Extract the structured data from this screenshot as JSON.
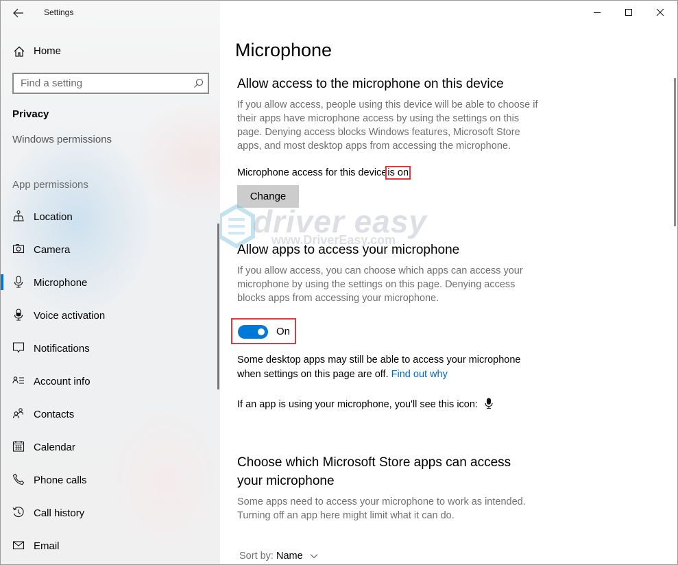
{
  "window": {
    "title": "Settings",
    "controls": {
      "minimize": "minimize",
      "maximize": "maximize",
      "close": "close"
    }
  },
  "sidebar": {
    "home_label": "Home",
    "search_placeholder": "Find a setting",
    "section_title": "Privacy",
    "partial_item": "Windows permissions",
    "group_label": "App permissions",
    "items": [
      {
        "label": "Location",
        "icon": "location-icon",
        "selected": false
      },
      {
        "label": "Camera",
        "icon": "camera-icon",
        "selected": false
      },
      {
        "label": "Microphone",
        "icon": "microphone-icon",
        "selected": true
      },
      {
        "label": "Voice activation",
        "icon": "voice-activation-icon",
        "selected": false
      },
      {
        "label": "Notifications",
        "icon": "notifications-icon",
        "selected": false
      },
      {
        "label": "Account info",
        "icon": "account-info-icon",
        "selected": false
      },
      {
        "label": "Contacts",
        "icon": "contacts-icon",
        "selected": false
      },
      {
        "label": "Calendar",
        "icon": "calendar-icon",
        "selected": false
      },
      {
        "label": "Phone calls",
        "icon": "phone-icon",
        "selected": false
      },
      {
        "label": "Call history",
        "icon": "call-history-icon",
        "selected": false
      },
      {
        "label": "Email",
        "icon": "email-icon",
        "selected": false
      }
    ]
  },
  "main": {
    "title": "Microphone",
    "device_section": {
      "heading": "Allow access to the microphone on this device",
      "description": "If you allow access, people using this device will be able to choose if their apps have microphone access by using the settings on this page. Denying access blocks Windows features, Microsoft Store apps, and most desktop apps from accessing the microphone.",
      "status_prefix": "Microphone access for this device",
      "status_value": "is on",
      "change_button": "Change"
    },
    "apps_section": {
      "heading": "Allow apps to access your microphone",
      "description": "If you allow access, you can choose which apps can access your microphone by using the settings on this page. Denying access blocks apps from accessing your microphone.",
      "toggle_state": "On",
      "toggle_on": true,
      "note": "Some desktop apps may still be able to access your microphone when settings on this page are off.",
      "note_link": "Find out why",
      "icon_note": "If an app is using your microphone, you'll see this icon:"
    },
    "store_section": {
      "heading": "Choose which Microsoft Store apps can access your microphone",
      "description": "Some apps need to access your microphone to work as intended. Turning off an app here might limit what it can do.",
      "sort_label": "Sort by:",
      "sort_value": "Name"
    },
    "watermark": {
      "brand": "driver easy",
      "url": "www.DriverEasy.com"
    }
  },
  "colors": {
    "accent": "#0078d7",
    "link": "#0067c0",
    "highlight_box": "#e0393e",
    "button_bg": "#cccccc",
    "muted_text": "#6f6f6f"
  }
}
